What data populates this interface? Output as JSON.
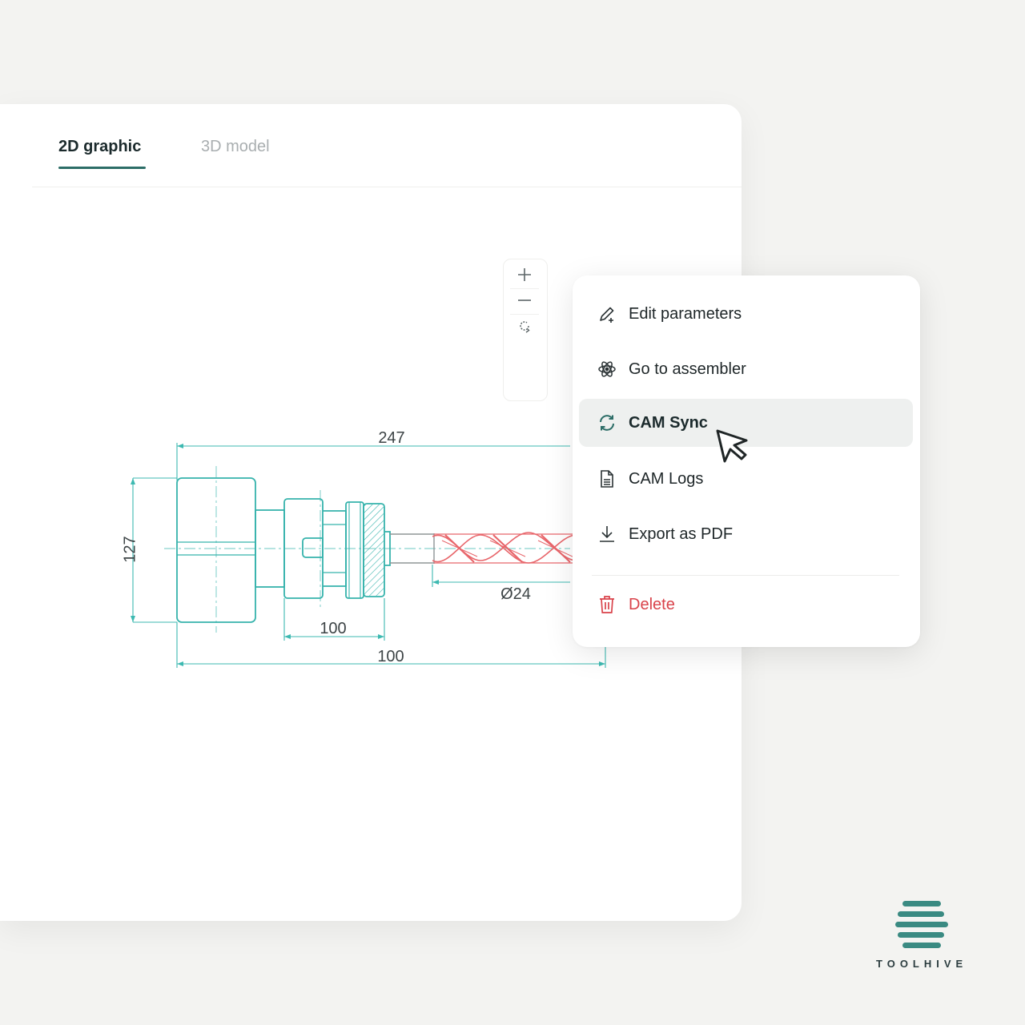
{
  "tabs": [
    {
      "label": "2D graphic",
      "active": true
    },
    {
      "label": "3D model",
      "active": false
    }
  ],
  "zoom_controls": {
    "zoom_in_icon": "plus-icon",
    "zoom_out_icon": "minus-icon",
    "reset_icon": "reset-view-icon"
  },
  "drawing": {
    "dimensions": {
      "overall_top": "247",
      "height": "127",
      "diameter": "Ø24",
      "collet_length": "100",
      "overall_bottom": "100"
    },
    "colors": {
      "body": "#36b3ac",
      "drill": "#e8666b",
      "dimension": "#3db9b1"
    }
  },
  "menu": {
    "items": [
      {
        "label": "Edit parameters",
        "icon": "edit-pen-plus-icon"
      },
      {
        "label": "Go to assembler",
        "icon": "assembler-atom-icon"
      },
      {
        "label": "CAM Sync",
        "icon": "sync-icon",
        "active": true
      },
      {
        "label": "CAM Logs",
        "icon": "document-log-icon"
      },
      {
        "label": "Export as PDF",
        "icon": "download-icon"
      },
      {
        "label": "Delete",
        "icon": "trash-icon",
        "danger": true
      }
    ]
  },
  "brand": {
    "name": "TOOLHIVE",
    "colors": {
      "logo": "#3a8a82",
      "text": "#2c3d40"
    }
  },
  "theme": {
    "accent": "#2c6d67",
    "danger": "#d9424a"
  }
}
